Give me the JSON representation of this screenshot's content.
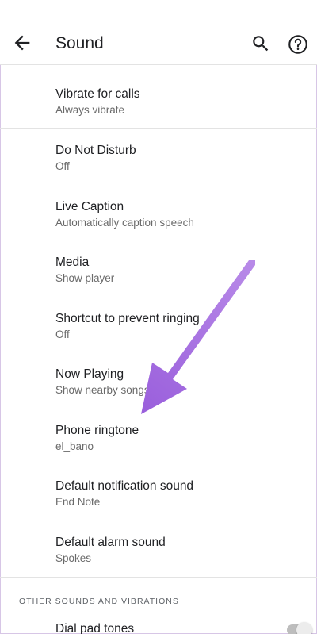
{
  "toolbar": {
    "title": "Sound",
    "back_icon": "arrow-back-icon",
    "search_icon": "search-icon",
    "help_icon": "help-icon"
  },
  "settings": [
    {
      "title": "Vibrate for calls",
      "subtitle": "Always vibrate"
    },
    {
      "title": "Do Not Disturb",
      "subtitle": "Off"
    },
    {
      "title": "Live Caption",
      "subtitle": "Automatically caption speech"
    },
    {
      "title": "Media",
      "subtitle": "Show player"
    },
    {
      "title": "Shortcut to prevent ringing",
      "subtitle": "Off"
    },
    {
      "title": "Now Playing",
      "subtitle": "Show nearby songs"
    },
    {
      "title": "Phone ringtone",
      "subtitle": "el_bano"
    },
    {
      "title": "Default notification sound",
      "subtitle": "End Note"
    },
    {
      "title": "Default alarm sound",
      "subtitle": "Spokes"
    }
  ],
  "other_section": {
    "header": "OTHER SOUNDS AND VIBRATIONS",
    "first_item": "Dial pad tones"
  },
  "colors": {
    "annotation_arrow": "#a66ee0"
  }
}
